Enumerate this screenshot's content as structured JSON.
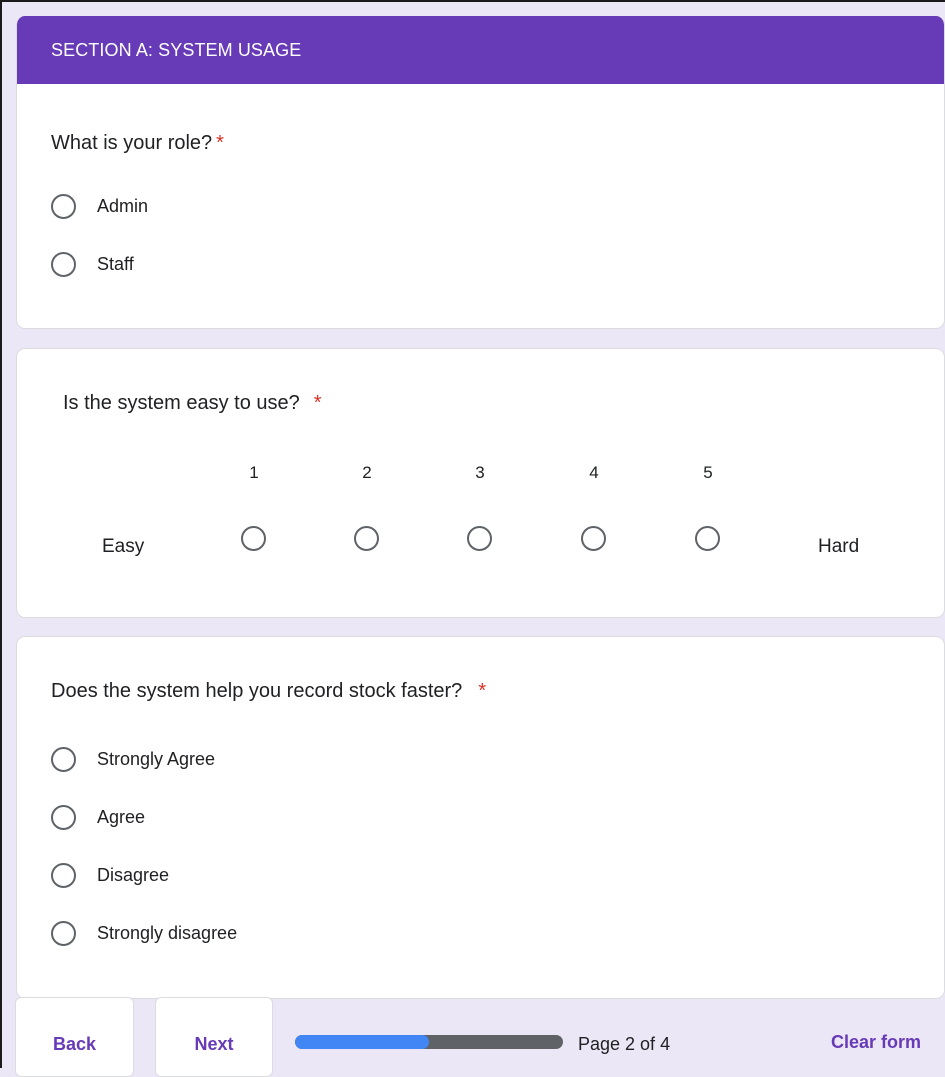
{
  "section": {
    "title": "SECTION A: SYSTEM USAGE"
  },
  "q1": {
    "text": "What is your role?",
    "required_mark": "*",
    "options": [
      "Admin",
      "Staff"
    ]
  },
  "q2": {
    "text": "Is the system easy to use?",
    "required_mark": "*",
    "scale": [
      "1",
      "2",
      "3",
      "4",
      "5"
    ],
    "low_label": "Easy",
    "high_label": "Hard"
  },
  "q3": {
    "text": "Does the system help you record stock faster?",
    "required_mark": "*",
    "options": [
      "Strongly Agree",
      "Agree",
      "Disagree",
      "Strongly disagree"
    ]
  },
  "nav": {
    "back_label": "Back",
    "next_label": "Next",
    "page_indicator": "Page 2 of 4",
    "progress_fraction": 0.5,
    "clear_label": "Clear form"
  },
  "colors": {
    "accent": "#673ab7",
    "required": "#d93025",
    "progress_fill": "#4285f4",
    "progress_track": "#5f6368",
    "page_background": "#ece7f6"
  }
}
